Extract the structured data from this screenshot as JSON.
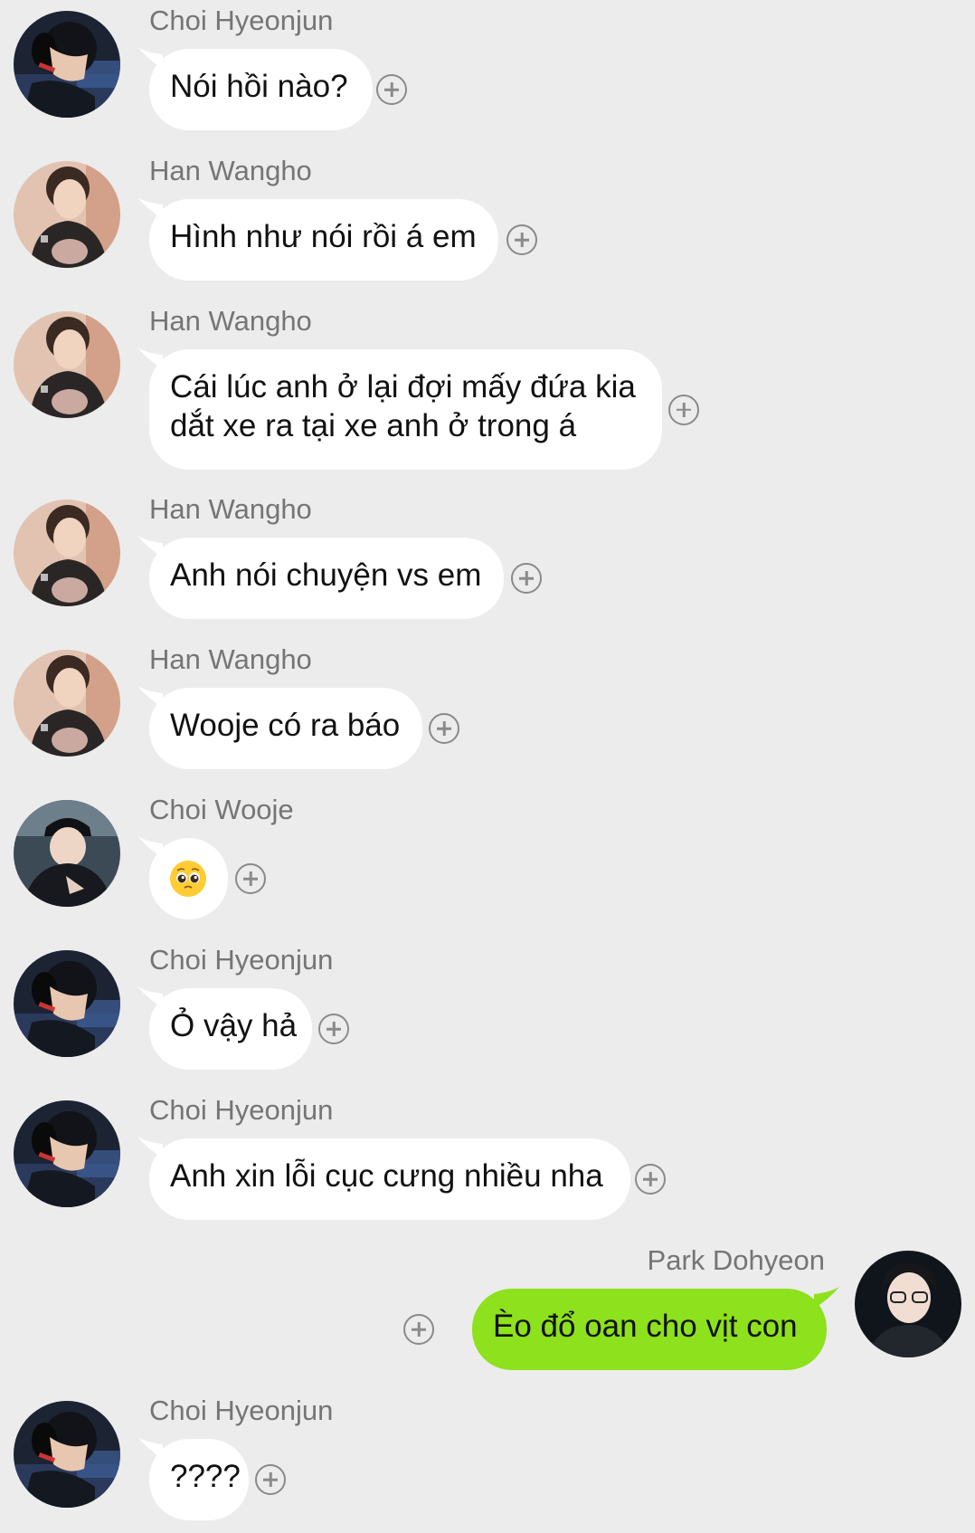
{
  "messages": [
    {
      "side": "left",
      "sender": "Choi Hyeonjun",
      "avatar": "hyeonjun",
      "lines": [
        "Nói hồi nào?"
      ],
      "add_icon": "plus-circle-icon"
    },
    {
      "side": "left",
      "sender": "Han Wangho",
      "avatar": "wangho",
      "lines": [
        "Hình như nói rồi á em"
      ],
      "add_icon": "plus-circle-icon"
    },
    {
      "side": "left",
      "sender": "Han Wangho",
      "avatar": "wangho",
      "lines": [
        "Cái lúc anh ở lại đợi mấy đứa kia",
        "dắt xe ra tại xe anh ở trong á"
      ],
      "add_icon": "plus-circle-icon"
    },
    {
      "side": "left",
      "sender": "Han Wangho",
      "avatar": "wangho",
      "lines": [
        "Anh nói chuyện vs em"
      ],
      "add_icon": "plus-circle-icon"
    },
    {
      "side": "left",
      "sender": "Han Wangho",
      "avatar": "wangho",
      "lines": [
        "Wooje có ra báo"
      ],
      "add_icon": "plus-circle-icon"
    },
    {
      "side": "left",
      "sender": "Choi Wooje",
      "avatar": "wooje",
      "lines": [],
      "emoji": "pleading-face-emoji",
      "add_icon": "plus-circle-icon"
    },
    {
      "side": "left",
      "sender": "Choi Hyeonjun",
      "avatar": "hyeonjun",
      "lines": [
        "Ỏ vậy hả"
      ],
      "add_icon": "plus-circle-icon"
    },
    {
      "side": "left",
      "sender": "Choi Hyeonjun",
      "avatar": "hyeonjun",
      "lines": [
        "Anh xin lỗi cục cưng nhiều nha"
      ],
      "add_icon": "plus-circle-icon"
    },
    {
      "side": "right",
      "sender": "Park Dohyeon",
      "avatar": "dohyeon",
      "lines": [
        "Èo đổ oan cho vịt con"
      ],
      "add_icon": "plus-circle-icon"
    },
    {
      "side": "left",
      "sender": "Choi Hyeonjun",
      "avatar": "hyeonjun",
      "lines": [
        "????"
      ],
      "add_icon": "plus-circle-icon"
    }
  ],
  "colors": {
    "background": "#ececec",
    "incoming_bubble": "#ffffff",
    "outgoing_bubble": "#8de11d",
    "sender_name": "#757575"
  }
}
